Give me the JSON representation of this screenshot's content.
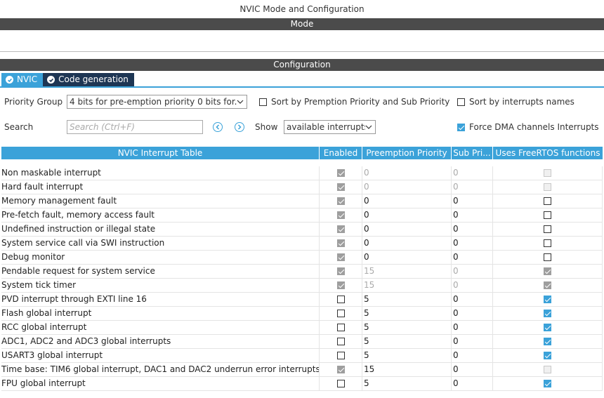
{
  "window": {
    "title": "NVIC Mode and Configuration"
  },
  "sections": {
    "mode": "Mode",
    "configuration": "Configuration"
  },
  "tabs": [
    {
      "label": "NVIC",
      "active": true
    },
    {
      "label": "Code generation",
      "active": false
    }
  ],
  "controls": {
    "priority_group_label": "Priority Group",
    "priority_group_value": "4 bits for pre-emption priority 0 bits for...",
    "sort_premption_label": "Sort by Premption Priority and Sub Priority",
    "sort_premption_checked": false,
    "sort_names_label": "Sort by interrupts names",
    "sort_names_checked": false,
    "search_label": "Search",
    "search_placeholder": "Search (Ctrl+F)",
    "show_label": "Show",
    "show_value": "available interrupts",
    "force_dma_label": "Force DMA channels Interrupts",
    "force_dma_checked": true
  },
  "table": {
    "columns": [
      "NVIC Interrupt Table",
      "Enabled",
      "Preemption Priority",
      "Sub Pri...",
      "Uses FreeRTOS functions"
    ],
    "rows": [
      {
        "name": "Non maskable interrupt",
        "enabled": true,
        "enabled_disabled": true,
        "preemption": "0",
        "sub": "0",
        "prio_disabled": true,
        "freertos": false,
        "freertos_disabled": true
      },
      {
        "name": "Hard fault interrupt",
        "enabled": true,
        "enabled_disabled": true,
        "preemption": "0",
        "sub": "0",
        "prio_disabled": true,
        "freertos": false,
        "freertos_disabled": true
      },
      {
        "name": "Memory management fault",
        "enabled": true,
        "enabled_disabled": true,
        "preemption": "0",
        "sub": "0",
        "prio_disabled": false,
        "freertos": false,
        "freertos_disabled": false
      },
      {
        "name": "Pre-fetch fault, memory access fault",
        "enabled": true,
        "enabled_disabled": true,
        "preemption": "0",
        "sub": "0",
        "prio_disabled": false,
        "freertos": false,
        "freertos_disabled": false
      },
      {
        "name": "Undefined instruction or illegal state",
        "enabled": true,
        "enabled_disabled": true,
        "preemption": "0",
        "sub": "0",
        "prio_disabled": false,
        "freertos": false,
        "freertos_disabled": false
      },
      {
        "name": "System service call via SWI instruction",
        "enabled": true,
        "enabled_disabled": true,
        "preemption": "0",
        "sub": "0",
        "prio_disabled": false,
        "freertos": false,
        "freertos_disabled": false
      },
      {
        "name": "Debug monitor",
        "enabled": true,
        "enabled_disabled": true,
        "preemption": "0",
        "sub": "0",
        "prio_disabled": false,
        "freertos": false,
        "freertos_disabled": false
      },
      {
        "name": "Pendable request for system service",
        "enabled": true,
        "enabled_disabled": true,
        "preemption": "15",
        "sub": "0",
        "prio_disabled": true,
        "freertos": true,
        "freertos_disabled": true
      },
      {
        "name": "System tick timer",
        "enabled": true,
        "enabled_disabled": true,
        "preemption": "15",
        "sub": "0",
        "prio_disabled": true,
        "freertos": true,
        "freertos_disabled": true
      },
      {
        "name": "PVD interrupt through EXTI line 16",
        "enabled": false,
        "enabled_disabled": false,
        "preemption": "5",
        "sub": "0",
        "prio_disabled": false,
        "freertos": true,
        "freertos_disabled": false
      },
      {
        "name": "Flash global interrupt",
        "enabled": false,
        "enabled_disabled": false,
        "preemption": "5",
        "sub": "0",
        "prio_disabled": false,
        "freertos": true,
        "freertos_disabled": false
      },
      {
        "name": "RCC global interrupt",
        "enabled": false,
        "enabled_disabled": false,
        "preemption": "5",
        "sub": "0",
        "prio_disabled": false,
        "freertos": true,
        "freertos_disabled": false
      },
      {
        "name": "ADC1, ADC2 and ADC3 global interrupts",
        "enabled": false,
        "enabled_disabled": false,
        "preemption": "5",
        "sub": "0",
        "prio_disabled": false,
        "freertos": true,
        "freertos_disabled": false
      },
      {
        "name": "USART3 global interrupt",
        "enabled": false,
        "enabled_disabled": false,
        "preemption": "5",
        "sub": "0",
        "prio_disabled": false,
        "freertos": true,
        "freertos_disabled": false
      },
      {
        "name": "Time base: TIM6 global interrupt, DAC1 and DAC2 underrun error interrupts",
        "enabled": true,
        "enabled_disabled": true,
        "preemption": "15",
        "sub": "0",
        "prio_disabled": false,
        "freertos": false,
        "freertos_disabled": true
      },
      {
        "name": "FPU global interrupt",
        "enabled": false,
        "enabled_disabled": false,
        "preemption": "5",
        "sub": "0",
        "prio_disabled": false,
        "freertos": true,
        "freertos_disabled": false
      }
    ]
  },
  "colors": {
    "accent": "#3ba2d9",
    "header_bar": "#4b4b4b",
    "tab_inactive": "#1e3654"
  }
}
